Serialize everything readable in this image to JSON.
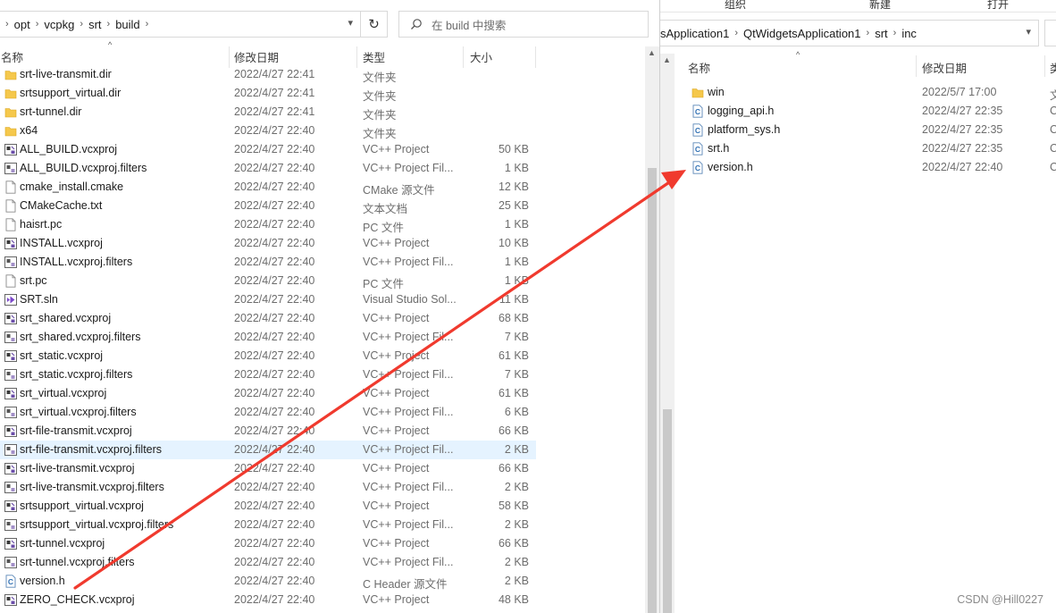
{
  "left_window": {
    "breadcrumb": [
      "opt",
      "vcpkg",
      "srt",
      "build"
    ],
    "search_placeholder": "在 build 中搜索",
    "columns": {
      "name": "名称",
      "date": "修改日期",
      "type": "类型",
      "size": "大小"
    },
    "files": [
      {
        "icon": "folder-icon",
        "name": "srt-live-transmit.dir",
        "date": "2022/4/27 22:41",
        "type": "文件夹",
        "size": ""
      },
      {
        "icon": "folder-icon",
        "name": "srtsupport_virtual.dir",
        "date": "2022/4/27 22:41",
        "type": "文件夹",
        "size": ""
      },
      {
        "icon": "folder-icon",
        "name": "srt-tunnel.dir",
        "date": "2022/4/27 22:41",
        "type": "文件夹",
        "size": ""
      },
      {
        "icon": "folder-icon",
        "name": "x64",
        "date": "2022/4/27 22:40",
        "type": "文件夹",
        "size": ""
      },
      {
        "icon": "vcxproj-icon",
        "name": "ALL_BUILD.vcxproj",
        "date": "2022/4/27 22:40",
        "type": "VC++ Project",
        "size": "50 KB"
      },
      {
        "icon": "filters-icon",
        "name": "ALL_BUILD.vcxproj.filters",
        "date": "2022/4/27 22:40",
        "type": "VC++ Project Fil...",
        "size": "1 KB"
      },
      {
        "icon": "file-icon",
        "name": "cmake_install.cmake",
        "date": "2022/4/27 22:40",
        "type": "CMake 源文件",
        "size": "12 KB"
      },
      {
        "icon": "file-icon",
        "name": "CMakeCache.txt",
        "date": "2022/4/27 22:40",
        "type": "文本文档",
        "size": "25 KB"
      },
      {
        "icon": "file-icon",
        "name": "haisrt.pc",
        "date": "2022/4/27 22:40",
        "type": "PC 文件",
        "size": "1 KB"
      },
      {
        "icon": "vcxproj-icon",
        "name": "INSTALL.vcxproj",
        "date": "2022/4/27 22:40",
        "type": "VC++ Project",
        "size": "10 KB"
      },
      {
        "icon": "filters-icon",
        "name": "INSTALL.vcxproj.filters",
        "date": "2022/4/27 22:40",
        "type": "VC++ Project Fil...",
        "size": "1 KB"
      },
      {
        "icon": "file-icon",
        "name": "srt.pc",
        "date": "2022/4/27 22:40",
        "type": "PC 文件",
        "size": "1 KB"
      },
      {
        "icon": "sln-icon",
        "name": "SRT.sln",
        "date": "2022/4/27 22:40",
        "type": "Visual Studio Sol...",
        "size": "11 KB"
      },
      {
        "icon": "vcxproj-icon",
        "name": "srt_shared.vcxproj",
        "date": "2022/4/27 22:40",
        "type": "VC++ Project",
        "size": "68 KB"
      },
      {
        "icon": "filters-icon",
        "name": "srt_shared.vcxproj.filters",
        "date": "2022/4/27 22:40",
        "type": "VC++ Project Fil...",
        "size": "7 KB"
      },
      {
        "icon": "vcxproj-icon",
        "name": "srt_static.vcxproj",
        "date": "2022/4/27 22:40",
        "type": "VC++ Project",
        "size": "61 KB"
      },
      {
        "icon": "filters-icon",
        "name": "srt_static.vcxproj.filters",
        "date": "2022/4/27 22:40",
        "type": "VC++ Project Fil...",
        "size": "7 KB"
      },
      {
        "icon": "vcxproj-icon",
        "name": "srt_virtual.vcxproj",
        "date": "2022/4/27 22:40",
        "type": "VC++ Project",
        "size": "61 KB"
      },
      {
        "icon": "filters-icon",
        "name": "srt_virtual.vcxproj.filters",
        "date": "2022/4/27 22:40",
        "type": "VC++ Project Fil...",
        "size": "6 KB"
      },
      {
        "icon": "vcxproj-icon",
        "name": "srt-file-transmit.vcxproj",
        "date": "2022/4/27 22:40",
        "type": "VC++ Project",
        "size": "66 KB"
      },
      {
        "icon": "filters-icon",
        "name": "srt-file-transmit.vcxproj.filters",
        "date": "2022/4/27 22:40",
        "type": "VC++ Project Fil...",
        "size": "2 KB"
      },
      {
        "icon": "vcxproj-icon",
        "name": "srt-live-transmit.vcxproj",
        "date": "2022/4/27 22:40",
        "type": "VC++ Project",
        "size": "66 KB"
      },
      {
        "icon": "filters-icon",
        "name": "srt-live-transmit.vcxproj.filters",
        "date": "2022/4/27 22:40",
        "type": "VC++ Project Fil...",
        "size": "2 KB"
      },
      {
        "icon": "vcxproj-icon",
        "name": "srtsupport_virtual.vcxproj",
        "date": "2022/4/27 22:40",
        "type": "VC++ Project",
        "size": "58 KB"
      },
      {
        "icon": "filters-icon",
        "name": "srtsupport_virtual.vcxproj.filters",
        "date": "2022/4/27 22:40",
        "type": "VC++ Project Fil...",
        "size": "2 KB"
      },
      {
        "icon": "vcxproj-icon",
        "name": "srt-tunnel.vcxproj",
        "date": "2022/4/27 22:40",
        "type": "VC++ Project",
        "size": "66 KB"
      },
      {
        "icon": "filters-icon",
        "name": "srt-tunnel.vcxproj.filters",
        "date": "2022/4/27 22:40",
        "type": "VC++ Project Fil...",
        "size": "2 KB"
      },
      {
        "icon": "header-icon",
        "name": "version.h",
        "date": "2022/4/27 22:40",
        "type": "C Header 源文件",
        "size": "2 KB"
      },
      {
        "icon": "vcxproj-icon",
        "name": "ZERO_CHECK.vcxproj",
        "date": "2022/4/27 22:40",
        "type": "VC++ Project",
        "size": "48 KB"
      }
    ],
    "selected_row": "srt-file-transmit.vcxproj.filters"
  },
  "right_window": {
    "ribbon": {
      "organize": "组织",
      "new": "新建",
      "open": "打开"
    },
    "breadcrumb": [
      "sApplication1",
      "QtWidgetsApplication1",
      "srt",
      "inc"
    ],
    "columns": {
      "name": "名称",
      "date": "修改日期",
      "type_partial": "类"
    },
    "files": [
      {
        "icon": "folder-icon",
        "name": "win",
        "date": "2022/5/7 17:00",
        "type_partial": "文"
      },
      {
        "icon": "header-icon",
        "name": "logging_api.h",
        "date": "2022/4/27 22:35",
        "type_partial": "C"
      },
      {
        "icon": "header-icon",
        "name": "platform_sys.h",
        "date": "2022/4/27 22:35",
        "type_partial": "C"
      },
      {
        "icon": "header-icon",
        "name": "srt.h",
        "date": "2022/4/27 22:35",
        "type_partial": "C"
      },
      {
        "icon": "header-icon",
        "name": "version.h",
        "date": "2022/4/27 22:40",
        "type_partial": "C"
      }
    ]
  },
  "annotation": {
    "color": "#f03a2e",
    "from": "left version.h",
    "to": "right version.h"
  },
  "watermark": "CSDN @Hill0227"
}
